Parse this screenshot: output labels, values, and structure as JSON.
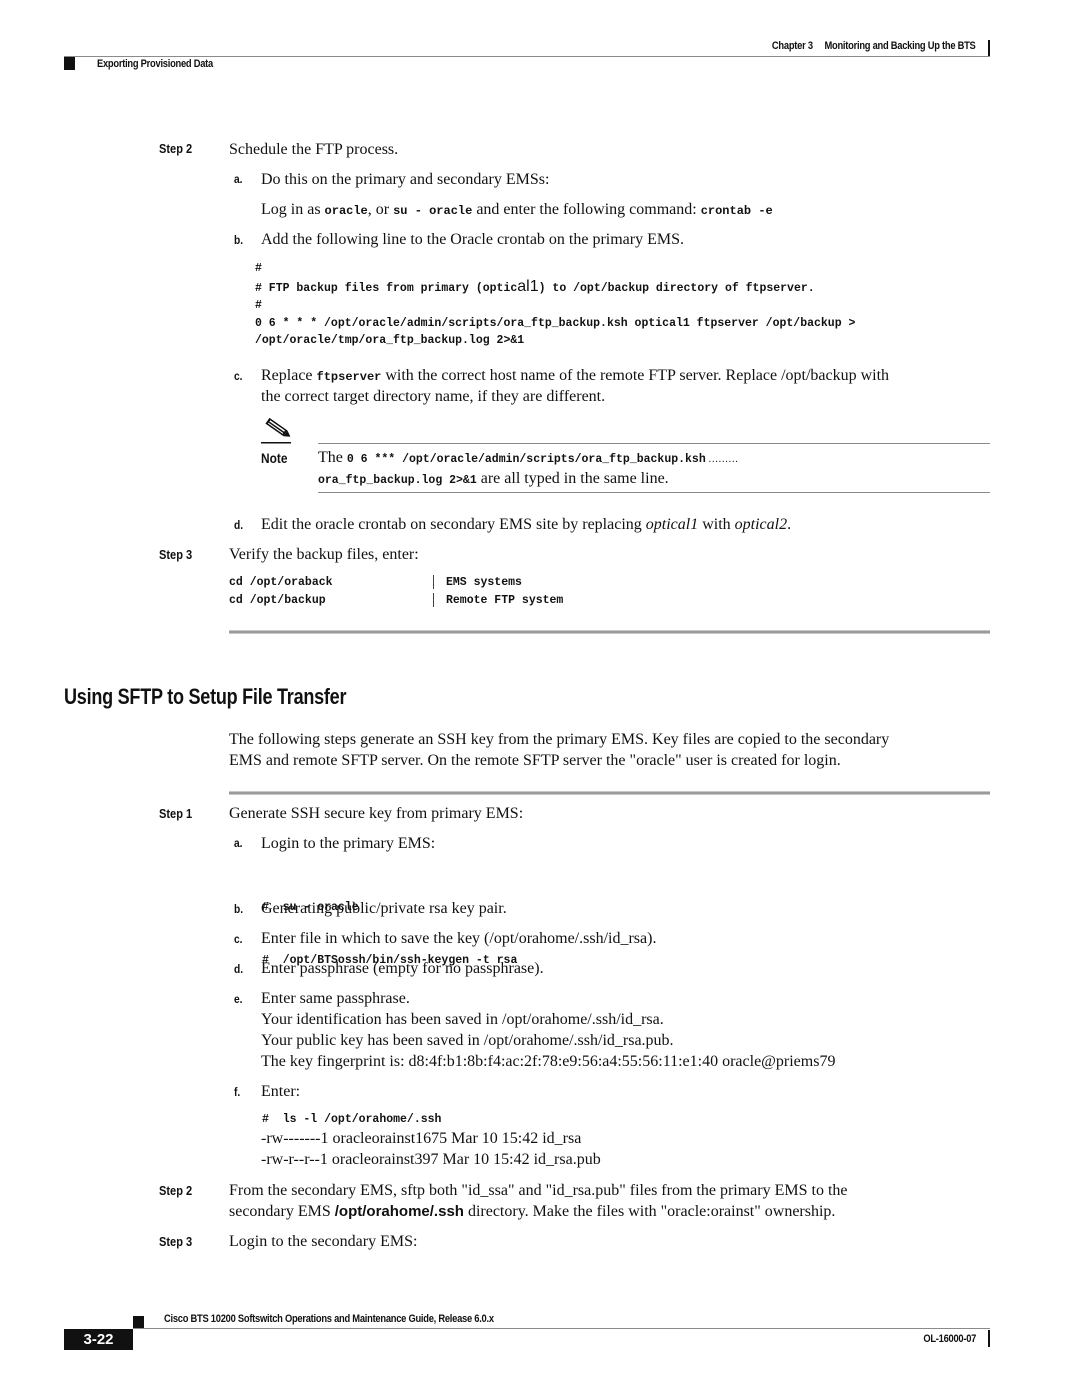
{
  "header": {
    "chapter": "Chapter 3",
    "chapter_title": "Monitoring and Backing Up the BTS",
    "section": "Exporting Provisioned Data"
  },
  "part1": {
    "step2": {
      "label": "Step 2",
      "text": "Schedule the FTP process.",
      "a": {
        "marker": "a.",
        "text": "Do this on the primary and secondary EMSs:",
        "login_pre": "Log in as ",
        "login_code1": "oracle",
        "login_mid": ", or ",
        "login_code2": "su - oracle",
        "login_post": " and enter the following command: ",
        "login_code3": "crontab -e"
      },
      "b": {
        "marker": "b.",
        "text": "Add the following line to the Oracle crontab on the primary EMS.",
        "code": {
          "line1": "#",
          "line2_pre": "# FTP backup files from primary (optic",
          "line2_big": "al1",
          "line2_post": ") to /opt/backup directory of ftpserver.",
          "line3": "#",
          "line4": "0 6 * * * /opt/oracle/admin/scripts/ora_ftp_backup.ksh optical1 ftpserver /opt/backup >",
          "line5": "/opt/oracle/tmp/ora_ftp_backup.log 2>&1"
        }
      },
      "c": {
        "marker": "c.",
        "pre": "Replace ",
        "code": "ftpserver",
        "post": " with the correct host name of the remote FTP server. Replace /opt/backup with",
        "line2": "the correct target directory name, if they are different."
      },
      "note": {
        "label": "Note",
        "icon": "pencil-note-icon",
        "pre": "The ",
        "code1": "0 6 *** /opt/oracle/admin/scripts/ora_ftp_backup.ksh",
        "dots": " ………",
        "code2": "ora_ftp_backup.log 2>&1",
        "post": " are all typed in the same line."
      },
      "d": {
        "marker": "d.",
        "pre": "Edit the oracle crontab on secondary EMS site by replacing ",
        "em1": "optical1",
        "mid": " with ",
        "em2": "optical2",
        "post": "."
      }
    },
    "step3": {
      "label": "Step 3",
      "text": "Verify the backup files, enter:",
      "rows": [
        {
          "cmd": "cd /opt/oraback",
          "desc": "EMS systems"
        },
        {
          "cmd": "cd /opt/backup",
          "desc": "Remote FTP system"
        }
      ]
    }
  },
  "section": {
    "title": "Using SFTP to Setup File Transfer",
    "intro_line1": "The following steps generate an SSH key from the primary EMS. Key files are copied to the secondary",
    "intro_line2": "EMS and remote SFTP server. On the remote SFTP server the \"oracle\" user is created for login.",
    "step1": {
      "label": "Step 1",
      "text": "Generate SSH secure key from primary EMS:",
      "a": {
        "marker": "a.",
        "text": "Login to the primary EMS:",
        "code1": "#  su - oracle",
        "code2": "#  /opt/BTSossh/bin/ssh-keygen -t rsa"
      },
      "b": {
        "marker": "b.",
        "text": "Generating public/private rsa key pair."
      },
      "c": {
        "marker": "c.",
        "text": "Enter file in which to save the key (/opt/orahome/.ssh/id_rsa)."
      },
      "d": {
        "marker": "d.",
        "text": "Enter passphrase (empty for no passphrase)."
      },
      "e": {
        "marker": "e.",
        "text": "Enter same passphrase.",
        "line2": "Your identification has been saved in /opt/orahome/.ssh/id_rsa.",
        "line3": "Your public key has been saved in /opt/orahome/.ssh/id_rsa.pub.",
        "line4": "The key fingerprint is: d8:4f:b1:8b:f4:ac:2f:78:e9:56:a4:55:56:11:e1:40 oracle@priems79"
      },
      "f": {
        "marker": "f.",
        "text": "Enter:",
        "code": "#  ls -l /opt/orahome/.ssh",
        "out1": "-rw-------1 oracleorainst1675 Mar 10 15:42 id_rsa",
        "out2": "-rw-r--r--1 oracleorainst397 Mar 10 15:42 id_rsa.pub"
      }
    },
    "step2": {
      "label": "Step 2",
      "line1": "From the secondary EMS, sftp both \"id_ssa\" and \"id_rsa.pub\" files from the primary EMS to the",
      "line2_pre": "secondary EMS ",
      "line2_bold": "/opt/orahome/.ssh",
      "line2_post": " directory.  Make the files with \"oracle:orainst\" ownership."
    },
    "step3": {
      "label": "Step 3",
      "text": "Login to the secondary EMS:"
    }
  },
  "footer": {
    "guide_title": "Cisco BTS 10200 Softswitch Operations and Maintenance Guide, Release 6.0.x",
    "page_number": "3-22",
    "doc_number": "OL-16000-07"
  }
}
